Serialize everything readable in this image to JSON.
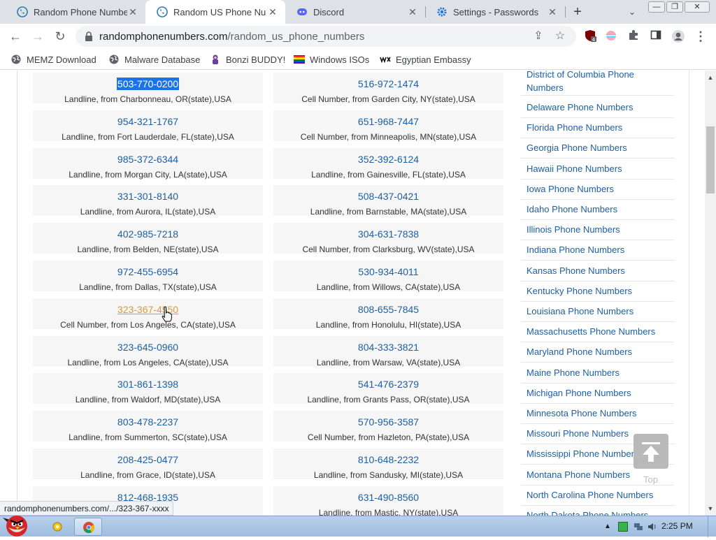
{
  "tabs": [
    {
      "title": "Random Phone Numbe",
      "close": "✕",
      "active": false
    },
    {
      "title": "Random US Phone Nu",
      "close": "✕",
      "active": true
    },
    {
      "title": "Discord",
      "close": "✕",
      "active": false
    },
    {
      "title": "Settings - Passwords",
      "close": "✕",
      "active": false
    }
  ],
  "new_tab": "+",
  "tab_search": "⌄",
  "window_controls": {
    "minimize": "—",
    "maximize": "❐",
    "close": "✕"
  },
  "toolbar": {
    "back": "←",
    "forward": "→",
    "reload": "↻",
    "url_domain": "randomphonenumbers.com",
    "url_path": "/random_us_phone_numbers",
    "share_icon": "⇪",
    "star_icon": "☆",
    "extension_badge": "4",
    "menu_icon": "⋮"
  },
  "bookmarks": [
    {
      "label": "MEMZ Download"
    },
    {
      "label": "Malware Database"
    },
    {
      "label": "Bonzi BUDDY!"
    },
    {
      "label": "Windows ISOs"
    },
    {
      "label": "Egyptian Embassy"
    }
  ],
  "numbers": [
    {
      "number": "503-770-0200",
      "desc": "Landline, from Charbonneau, OR(state),USA",
      "state": "selected"
    },
    {
      "number": "516-972-1474",
      "desc": "Cell Number, from Garden City, NY(state),USA",
      "state": ""
    },
    {
      "number": "954-321-1767",
      "desc": "Landline, from Fort Lauderdale, FL(state),USA",
      "state": ""
    },
    {
      "number": "651-968-7447",
      "desc": "Cell Number, from Minneapolis, MN(state),USA",
      "state": ""
    },
    {
      "number": "985-372-6344",
      "desc": "Landline, from Morgan City, LA(state),USA",
      "state": ""
    },
    {
      "number": "352-392-6124",
      "desc": "Landline, from Gainesville, FL(state),USA",
      "state": ""
    },
    {
      "number": "331-301-8140",
      "desc": "Landline, from Aurora, IL(state),USA",
      "state": ""
    },
    {
      "number": "508-437-0421",
      "desc": "Landline, from Barnstable, MA(state),USA",
      "state": ""
    },
    {
      "number": "402-985-7218",
      "desc": "Landline, from Belden, NE(state),USA",
      "state": ""
    },
    {
      "number": "304-631-7838",
      "desc": "Cell Number, from Clarksburg, WV(state),USA",
      "state": ""
    },
    {
      "number": "972-455-6954",
      "desc": "Landline, from Dallas, TX(state),USA",
      "state": ""
    },
    {
      "number": "530-934-4011",
      "desc": "Landline, from Willows, CA(state),USA",
      "state": ""
    },
    {
      "number": "323-367-4550",
      "desc": "Cell Number, from Los Angeles, CA(state),USA",
      "state": "hover"
    },
    {
      "number": "808-655-7845",
      "desc": "Landline, from Honolulu, HI(state),USA",
      "state": ""
    },
    {
      "number": "323-645-0960",
      "desc": "Landline, from Los Angeles, CA(state),USA",
      "state": ""
    },
    {
      "number": "804-333-3821",
      "desc": "Landline, from Warsaw, VA(state),USA",
      "state": ""
    },
    {
      "number": "301-861-1398",
      "desc": "Landline, from Waldorf, MD(state),USA",
      "state": ""
    },
    {
      "number": "541-476-2379",
      "desc": "Landline, from Grants Pass, OR(state),USA",
      "state": ""
    },
    {
      "number": "803-478-2237",
      "desc": "Landline, from Summerton, SC(state),USA",
      "state": ""
    },
    {
      "number": "570-956-3587",
      "desc": "Cell Number, from Hazleton, PA(state),USA",
      "state": ""
    },
    {
      "number": "208-425-0477",
      "desc": "Landline, from Grace, ID(state),USA",
      "state": ""
    },
    {
      "number": "810-648-2232",
      "desc": "Landline, from Sandusky, MI(state),USA",
      "state": ""
    },
    {
      "number": "812-468-1935",
      "desc": "",
      "state": ""
    },
    {
      "number": "631-490-8560",
      "desc": "Landline, from Mastic, NY(state),USA",
      "state": ""
    }
  ],
  "sidebar": [
    {
      "label": "District of Columbia Phone Numbers",
      "label2": "Numbers",
      "label1": "District of Columbia Phone"
    },
    {
      "label": "Delaware Phone Numbers"
    },
    {
      "label": "Florida Phone Numbers"
    },
    {
      "label": "Georgia Phone Numbers"
    },
    {
      "label": "Hawaii Phone Numbers"
    },
    {
      "label": "Iowa Phone Numbers"
    },
    {
      "label": "Idaho Phone Numbers"
    },
    {
      "label": "Illinois Phone Numbers"
    },
    {
      "label": "Indiana Phone Numbers"
    },
    {
      "label": "Kansas Phone Numbers"
    },
    {
      "label": "Kentucky Phone Numbers"
    },
    {
      "label": "Louisiana Phone Numbers"
    },
    {
      "label": "Massachusetts Phone Numbers"
    },
    {
      "label": "Maryland Phone Numbers"
    },
    {
      "label": "Maine Phone Numbers"
    },
    {
      "label": "Michigan Phone Numbers"
    },
    {
      "label": "Minnesota Phone Numbers"
    },
    {
      "label": "Missouri Phone Numbers"
    },
    {
      "label": "Mississippi Phone Numbers"
    },
    {
      "label": "Montana Phone Numbers"
    },
    {
      "label": "North Carolina Phone Numbers"
    },
    {
      "label": "North Dakota Phone Numbers"
    }
  ],
  "back_to_top_label": "Top",
  "status_url": "randomphonenumbers.com/.../323-367-xxxx",
  "clock": "2:25 PM",
  "colors": {
    "link": "#1d5fa3",
    "visited_hover": "#d99a3a",
    "selection": "#1a73e8"
  }
}
